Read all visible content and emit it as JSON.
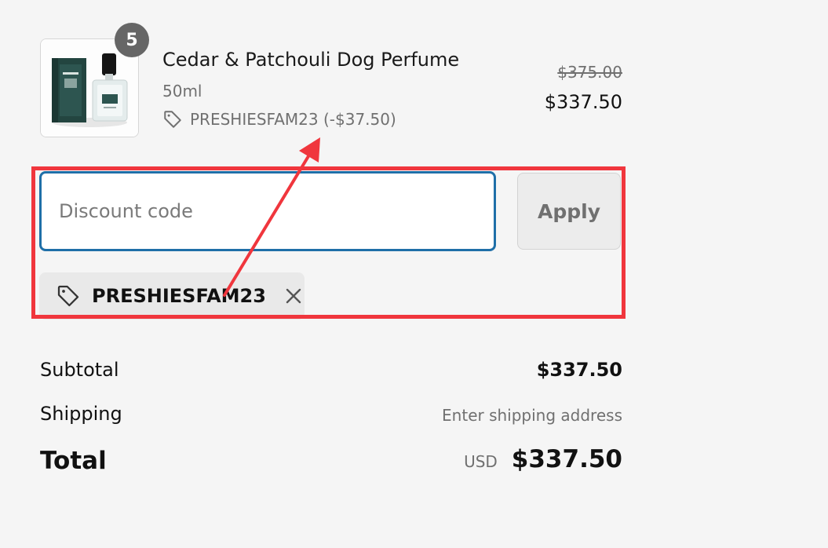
{
  "product": {
    "quantity": "5",
    "title": "Cedar & Patchouli Dog Perfume",
    "variant": "50ml",
    "discount_line": "PRESHIESFAM23 (-$37.50)",
    "original_price": "$375.00",
    "price": "$337.50",
    "image_icon": "perfume-bottle-box"
  },
  "discount": {
    "placeholder": "Discount code",
    "value": "",
    "apply_label": "Apply",
    "applied_code": "PRESHIESFAM23",
    "tag_icon": "tag-icon",
    "remove_icon": "close-icon"
  },
  "summary": {
    "subtotal_label": "Subtotal",
    "subtotal_value": "$337.50",
    "shipping_label": "Shipping",
    "shipping_value": "Enter shipping address",
    "total_label": "Total",
    "currency": "USD",
    "total_value": "$337.50"
  },
  "colors": {
    "annotation": "#f0363d",
    "input_focus": "#1f6fa8",
    "badge": "#666666"
  }
}
